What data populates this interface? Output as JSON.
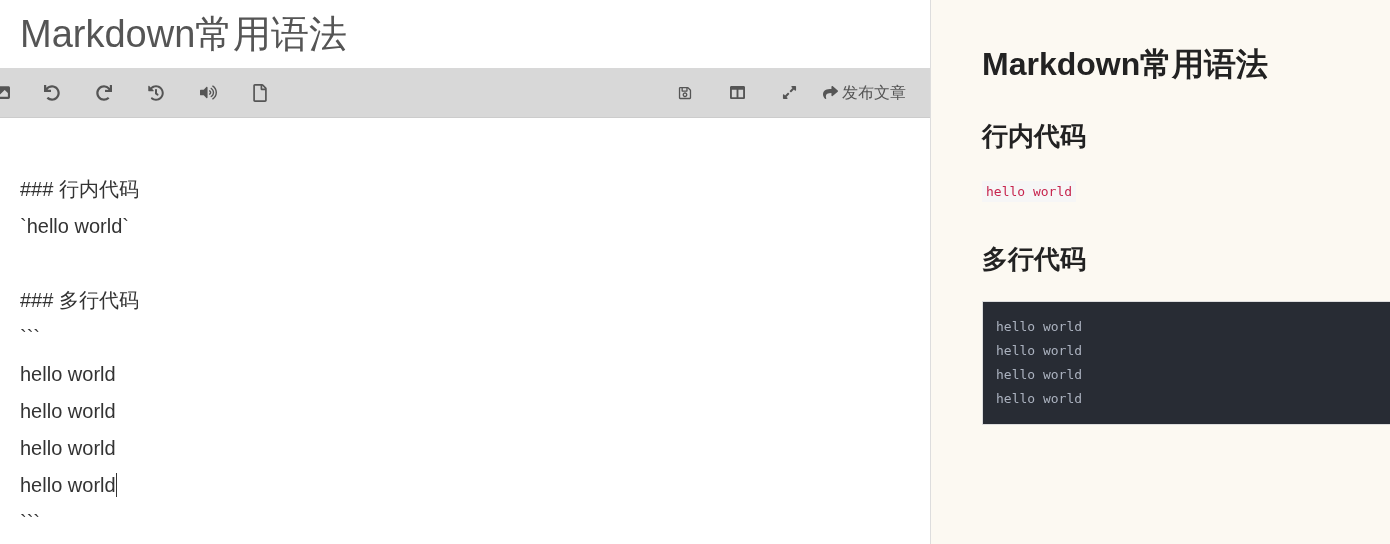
{
  "editor": {
    "title": "Markdown常用语法",
    "toolbar": {
      "publish_button": "发布文章"
    },
    "lines": [
      {
        "text": "### 行内代码",
        "has_cursor": false
      },
      {
        "text": "`hello world`",
        "has_cursor": false
      },
      {
        "has_cursor": false
      },
      {
        "text": "### 多行代码",
        "has_cursor": false
      },
      {
        "text": "```",
        "has_cursor": false
      },
      {
        "text": "hello world",
        "has_cursor": false
      },
      {
        "text": "hello world",
        "has_cursor": false
      },
      {
        "text": "hello world",
        "has_cursor": false
      },
      {
        "text": "hello world",
        "has_cursor": true
      },
      {
        "text": "```",
        "has_cursor": false
      }
    ]
  },
  "preview": {
    "blocks": [
      {
        "kind": "h1",
        "text": "Markdown常用语法"
      },
      {
        "kind": "h3",
        "text": "行内代码"
      },
      {
        "kind": "inline_code",
        "text": "hello world"
      },
      {
        "kind": "h3",
        "text": "多行代码"
      },
      {
        "kind": "code_block",
        "lines": [
          "hello world",
          "hello world",
          "hello world",
          "hello world"
        ]
      }
    ]
  }
}
